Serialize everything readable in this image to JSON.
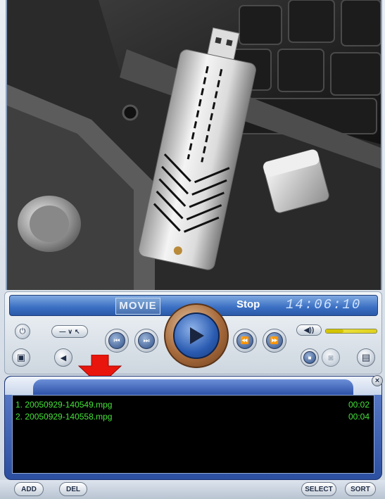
{
  "display": {
    "logo": "MOVIE",
    "status": "Stop",
    "time": "14:06:10"
  },
  "controls": {
    "select_label": "SELECT",
    "sort_label": "SORT",
    "add_label": "ADD",
    "del_label": "DEL",
    "volume_level": 0.35
  },
  "playlist": {
    "items": [
      {
        "name": "1. 20050929-140549.mpg",
        "duration": "00:02"
      },
      {
        "name": "2. 20050929-140558.mpg",
        "duration": "00:04"
      }
    ]
  },
  "icons": {
    "power": "power-icon",
    "minimize": "minimize-icon",
    "dropdown": "dropdown-icon",
    "expand": "expand-icon",
    "prev_frame": "step-back-icon",
    "next_frame": "step-forward-icon",
    "play": "play-icon",
    "rewind": "rewind-icon",
    "fast_forward": "fast-forward-icon",
    "volume": "speaker-icon",
    "stop": "stop-icon",
    "snapshot": "camera-icon",
    "playlist": "playlist-icon",
    "fullscreen": "screen-icon",
    "close": "close-icon"
  },
  "colors": {
    "playlist_text": "#46e23a",
    "accent_blue": "#2a5bb1",
    "arrow_red": "#e8160c"
  }
}
